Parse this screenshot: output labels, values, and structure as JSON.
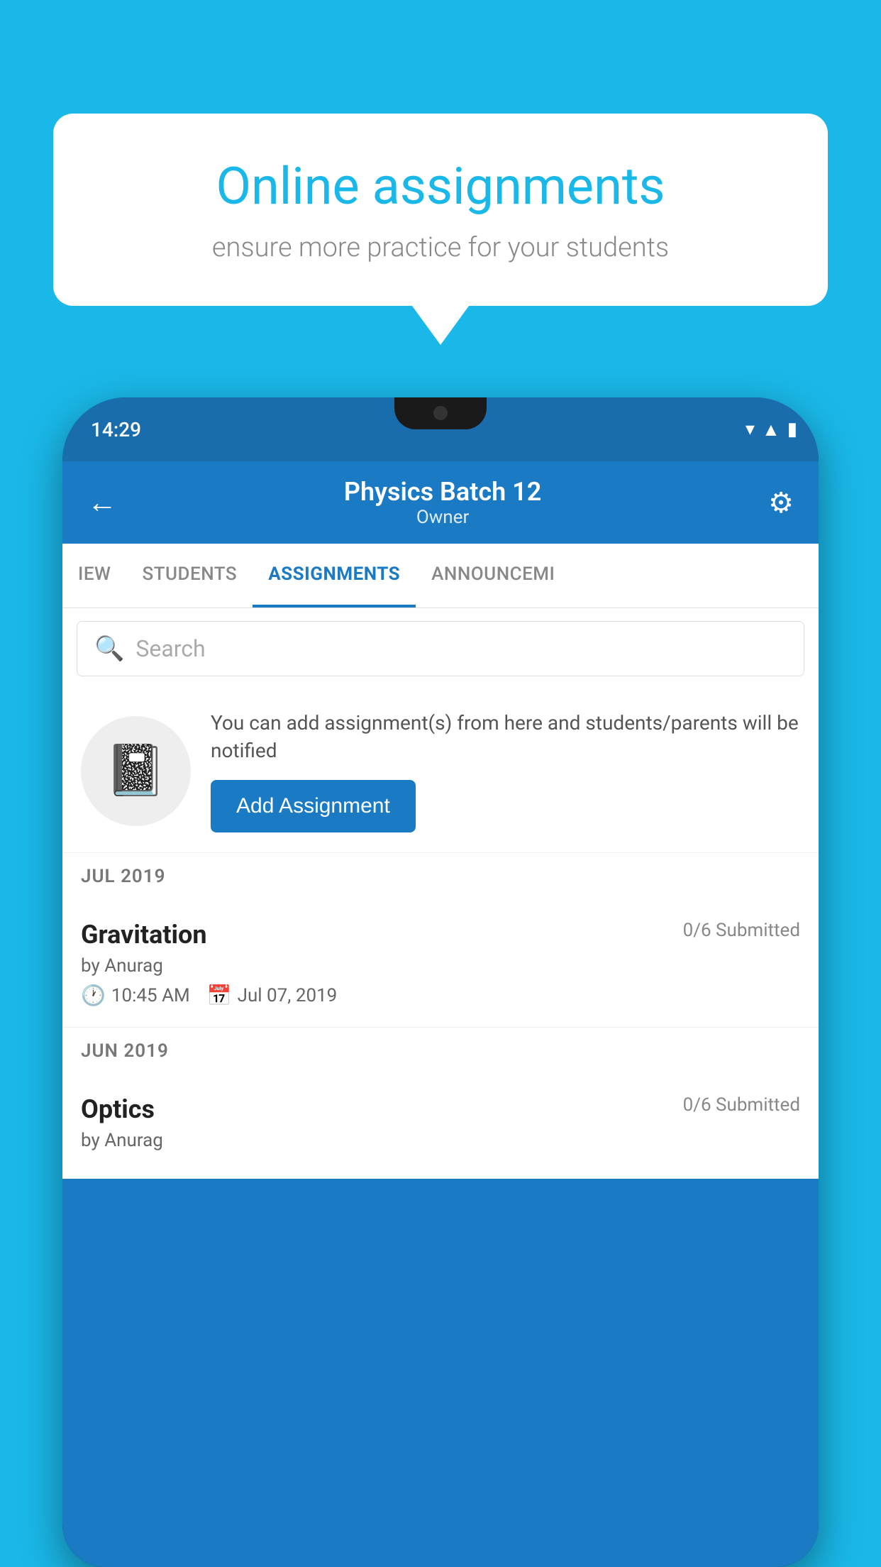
{
  "background_color": "#1ab8e8",
  "speech_bubble": {
    "title": "Online assignments",
    "subtitle": "ensure more practice for your students"
  },
  "phone": {
    "status_bar": {
      "time": "14:29",
      "wifi": "▾",
      "signal": "▲",
      "battery": "▮"
    },
    "header": {
      "title": "Physics Batch 12",
      "subtitle": "Owner",
      "back_label": "←",
      "settings_label": "⚙"
    },
    "tabs": [
      {
        "label": "IEW",
        "active": false
      },
      {
        "label": "STUDENTS",
        "active": false
      },
      {
        "label": "ASSIGNMENTS",
        "active": true
      },
      {
        "label": "ANNOUNCEMI",
        "active": false
      }
    ],
    "search": {
      "placeholder": "Search"
    },
    "info_card": {
      "description": "You can add assignment(s) from here and students/parents will be notified",
      "button_label": "Add Assignment"
    },
    "sections": [
      {
        "label": "JUL 2019",
        "assignments": [
          {
            "name": "Gravitation",
            "submitted": "0/6 Submitted",
            "by": "by Anurag",
            "time": "10:45 AM",
            "date": "Jul 07, 2019"
          }
        ]
      },
      {
        "label": "JUN 2019",
        "assignments": [
          {
            "name": "Optics",
            "submitted": "0/6 Submitted",
            "by": "by Anurag",
            "time": "",
            "date": ""
          }
        ]
      }
    ]
  }
}
